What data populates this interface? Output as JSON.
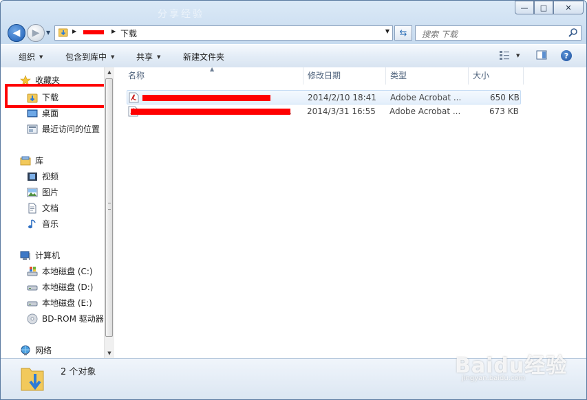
{
  "window": {
    "title": "分享经验"
  },
  "window_buttons": {
    "minimize": "—",
    "maximize": "□",
    "close": "✕"
  },
  "address": {
    "current_folder": "下载",
    "redacted_segment": ""
  },
  "search": {
    "placeholder": "搜索 下载"
  },
  "toolbar": {
    "organize": "组织",
    "include_in_library": "包含到库中",
    "share": "共享",
    "new_folder": "新建文件夹"
  },
  "nav": {
    "favorites_header": "收藏夹",
    "favorites": [
      {
        "label": "下载"
      },
      {
        "label": "桌面"
      },
      {
        "label": "最近访问的位置"
      }
    ],
    "libraries_header": "库",
    "libraries": [
      {
        "label": "视频"
      },
      {
        "label": "图片"
      },
      {
        "label": "文档"
      },
      {
        "label": "音乐"
      }
    ],
    "computer_header": "计算机",
    "drives": [
      {
        "label": "本地磁盘 (C:)"
      },
      {
        "label": "本地磁盘 (D:)"
      },
      {
        "label": "本地磁盘 (E:)"
      },
      {
        "label": "BD-ROM 驱动器"
      }
    ],
    "network_header": "网络"
  },
  "columns": {
    "name": "名称",
    "modified": "修改日期",
    "type": "类型",
    "size": "大小"
  },
  "files": [
    {
      "name": "",
      "modified": "2014/2/10 18:41",
      "type": "Adobe Acrobat ...",
      "size": "650 KB"
    },
    {
      "name": ".",
      "modified": "2014/3/31 16:55",
      "type": "Adobe Acrobat ...",
      "size": "673 KB"
    }
  ],
  "status": {
    "count_text": "2 个对象"
  },
  "watermark": {
    "logo": "Baidu经验",
    "url": "jingyan.baidu.com"
  },
  "colors": {
    "highlight_box": "#ff0000",
    "redaction": "#ff0000",
    "selection": "#e4effb"
  }
}
